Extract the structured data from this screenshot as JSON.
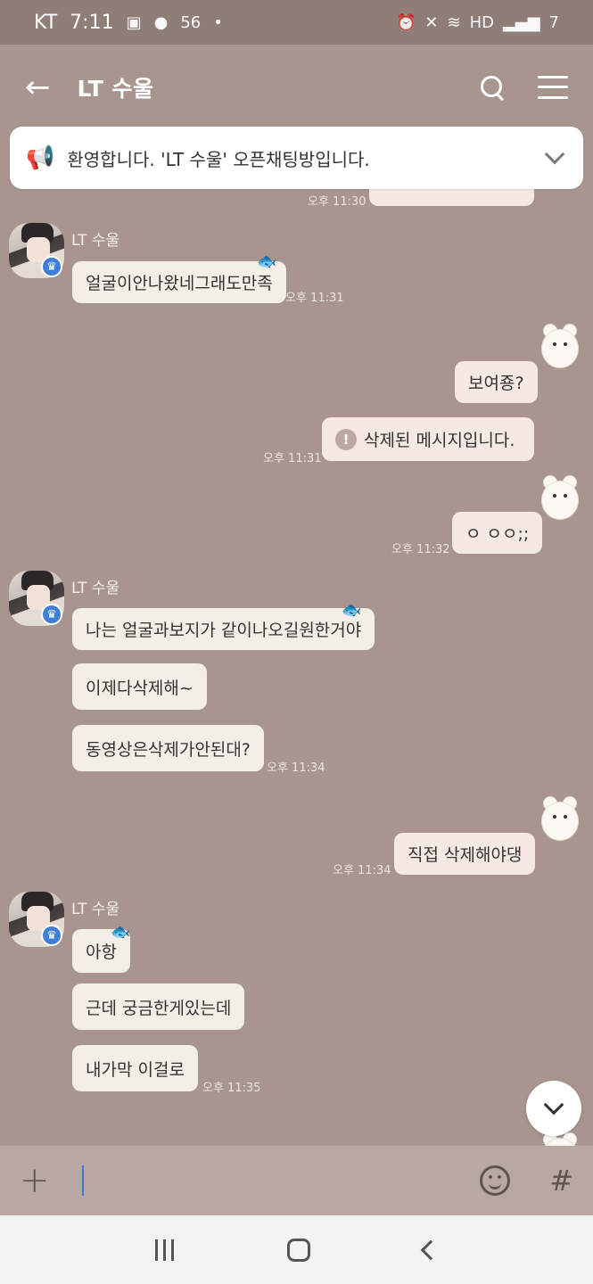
{
  "status_bar": {
    "carrier": "KT",
    "time": "7:11",
    "network": "56",
    "battery": "7"
  },
  "header": {
    "title": "LT 수울"
  },
  "notice": {
    "text": "환영합니다. 'LT 수울' 오픈채팅방입니다."
  },
  "messages": [
    {
      "sender": "other",
      "name": "LT 수울",
      "text": "얼굴이안나왔네그래도만족",
      "time": "오후 11:31"
    },
    {
      "sender": "me",
      "text": "보여죵?",
      "time": ""
    },
    {
      "sender": "me",
      "text": "삭제된 메시지입니다.",
      "time": "오후 11:31",
      "deleted": true
    },
    {
      "sender": "me",
      "text": "ㅇ ㅇㅇ;;",
      "time": "오후 11:32"
    },
    {
      "sender": "other",
      "name": "LT 수울",
      "text": "나는 얼굴과보지가 같이나오길원한거야",
      "time": ""
    },
    {
      "sender": "other",
      "text": "이제다삭제해~",
      "time": ""
    },
    {
      "sender": "other",
      "text": "동영상은삭제가안된대?",
      "time": "오후 11:34"
    },
    {
      "sender": "me",
      "text": "직접 삭제해야댕",
      "time": "오후 11:34"
    },
    {
      "sender": "other",
      "name": "LT 수울",
      "text": "아항",
      "time": ""
    },
    {
      "sender": "other",
      "text": "근데 궁금한게있는데",
      "time": ""
    },
    {
      "sender": "other",
      "text": "내가막 이걸로",
      "time": "오후 11:35"
    }
  ],
  "partial_top": {
    "time": "오후 11:30"
  },
  "input": {
    "placeholder": "",
    "value": ""
  },
  "colors": {
    "background": "#a8958f",
    "bubble_in": "#f4efe6",
    "bubble_out": "#f6e8e2"
  }
}
